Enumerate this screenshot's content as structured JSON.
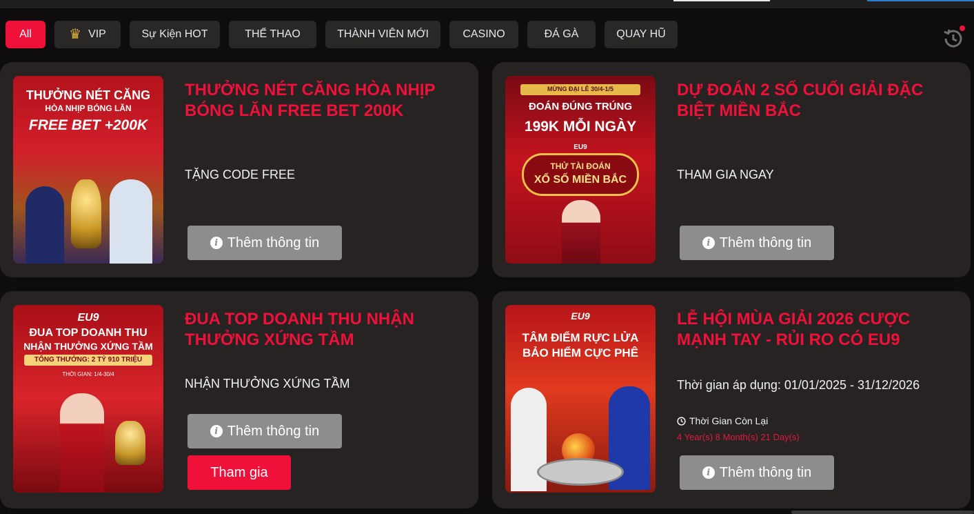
{
  "tabs": [
    {
      "label": "All"
    },
    {
      "label": "VIP"
    },
    {
      "label": "Sự Kiện HOT"
    },
    {
      "label": "THỂ THAO"
    },
    {
      "label": "THÀNH VIÊN MỚI"
    },
    {
      "label": "CASINO"
    },
    {
      "label": "ĐÁ GÀ"
    },
    {
      "label": "QUAY HŨ"
    }
  ],
  "colors": {
    "accent": "#f0113a",
    "card_bg": "#272322",
    "info_button": "#8d8d8d"
  },
  "icons": {
    "vip": "crown-icon",
    "history": "history-icon",
    "info": "info-icon",
    "clock": "clock-icon"
  },
  "promotions": [
    {
      "title": "THƯỞNG NÉT CĂNG HÒA NHỊP BÓNG LĂN FREE BET 200K",
      "subtitle": "TẶNG CODE FREE",
      "info_label": "Thêm thông tin",
      "banner": {
        "line1": "THƯỞNG NÉT CĂNG",
        "line2": "HÒA NHỊP BÓNG LĂN",
        "line3": "FREE BET +200K"
      }
    },
    {
      "title": "DỰ ĐOÁN 2 SỐ CUỐI GIẢI ĐẶC BIỆT MIỀN BẮC",
      "subtitle": "THAM GIA NGAY",
      "info_label": "Thêm thông tin",
      "banner": {
        "line1": "MỪNG ĐẠI LỄ 30/4-1/5",
        "line2": "ĐOÁN ĐÚNG TRÚNG",
        "line3": "199K MỖI NGÀY",
        "brand": "EU9",
        "line4": "THỬ TÀI ĐOÁN",
        "line5": "XỔ SỐ MIỀN BẮC"
      }
    },
    {
      "title": "ĐUA TOP DOANH THU NHẬN THƯỞNG XỨNG TẦM",
      "subtitle": "NHẬN THƯỞNG XỨNG TẦM",
      "info_label": "Thêm thông tin",
      "join_label": "Tham gia",
      "banner": {
        "brand": "EU9",
        "line1": "ĐUA TOP DOANH THU",
        "line2": "NHẬN THƯỞNG XỨNG TẦM",
        "line3": "TỔNG THƯỞNG: 2 TỶ 910 TRIỆU",
        "line4": "THỜI GIAN: 1/4-30/4"
      }
    },
    {
      "title": "LỄ HỘI MÙA GIẢI 2026 CƯỢC MẠNH TAY - RỦI RO CÓ EU9",
      "subtitle": "Thời gian áp dụng: 01/01/2025 - 31/12/2026",
      "timer_label": "Thời Gian Còn Lại",
      "timer_value": "4 Year(s) 8 Month(s) 21 Day(s)",
      "info_label": "Thêm thông tin",
      "banner": {
        "brand": "EU9",
        "line1": "TÂM ĐIỂM RỰC LỬA",
        "line2": "BẢO HIỂM CỰC PHÊ"
      }
    }
  ]
}
